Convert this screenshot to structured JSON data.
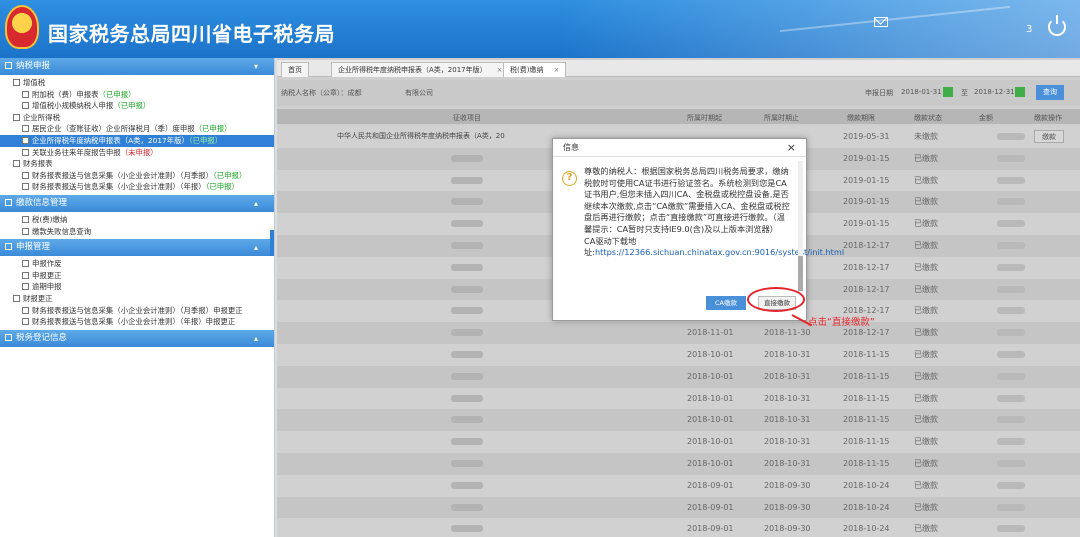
{
  "header": {
    "title": "国家税务总局四川省电子税务局",
    "user_num": "3"
  },
  "sidebar": {
    "sections": [
      {
        "title": "纳税申报",
        "items": [
          {
            "label": "增值税",
            "status": "",
            "level": 1
          },
          {
            "label": "附加税（费）申报表",
            "status": "（已申报）",
            "level": 2
          },
          {
            "label": "增值税小规模纳税人申报",
            "status": "（已申报）",
            "level": 2
          },
          {
            "label": "企业所得税",
            "status": "",
            "level": 1
          },
          {
            "label": "居民企业（查账征收）企业所得税月（季）度申报",
            "status": "（已申报）",
            "level": 2
          },
          {
            "label": "企业所得税年度纳税申报表（A类，2017年版）",
            "status": "（已申报）",
            "level": 2,
            "selected": true
          },
          {
            "label": "关联业务往来年度报告申报",
            "status": "（未申报）",
            "status_color": "red",
            "level": 2
          },
          {
            "label": "财务报表",
            "status": "",
            "level": 1
          },
          {
            "label": "财务报表报送与信息采集（小企业会计准则）（月季报）",
            "status": "（已申报）",
            "level": 2
          },
          {
            "label": "财务报表报送与信息采集（小企业会计准则）（年报）",
            "status": "（已申报）",
            "level": 2
          }
        ]
      },
      {
        "title": "缴款信息管理",
        "items": [
          {
            "label": "税(费)缴纳",
            "status": "",
            "level": 3
          },
          {
            "label": "缴款失败信息查询",
            "status": "",
            "level": 3
          }
        ]
      },
      {
        "title": "申报管理",
        "items": [
          {
            "label": "申报作废",
            "status": "",
            "level": 3
          },
          {
            "label": "申报更正",
            "status": "",
            "level": 3
          },
          {
            "label": "逾期申报",
            "status": "",
            "level": 3
          },
          {
            "label": "财报更正",
            "status": "",
            "level": 1
          },
          {
            "label": "财务报表报送与信息采集（小企业会计准则）（月季报）申报更正",
            "status": "",
            "level": 2
          },
          {
            "label": "财务报表报送与信息采集（小企业会计准则）（年报）申报更正",
            "status": "",
            "level": 2
          }
        ]
      },
      {
        "title": "税务登记信息",
        "items": []
      }
    ]
  },
  "tabs": [
    {
      "label": "首页"
    },
    {
      "label": "企业所得税年度纳税申报表（A类，2017年版）"
    },
    {
      "label": "税(费)缴纳"
    }
  ],
  "toolbar": {
    "taxpayer_label": "纳税人名称（公章）：成都",
    "taxpayer_suffix": "有限公司",
    "date_label": "申报日期",
    "date_from": "2018-01-31",
    "date_sep": "至",
    "date_to": "2018-12-31",
    "query_button": "查询"
  },
  "table": {
    "headers": [
      "征收项目",
      "所属时期起",
      "所属时期止",
      "缴款期限",
      "缴款状态",
      "金额",
      "缴款操作"
    ],
    "first_row_name": "中华人民共和国企业所得税年度纳税申报表（A类，20",
    "op_label": "缴款",
    "rows": [
      {
        "start": "",
        "end": "",
        "deadline": "2019-05-31",
        "status": "未缴款"
      },
      {
        "start": "",
        "end": "",
        "deadline": "2019-01-15",
        "status": "已缴款"
      },
      {
        "start": "",
        "end": "",
        "deadline": "2019-01-15",
        "status": "已缴款"
      },
      {
        "start": "",
        "end": "",
        "deadline": "2019-01-15",
        "status": "已缴款"
      },
      {
        "start": "",
        "end": "",
        "deadline": "2019-01-15",
        "status": "已缴款"
      },
      {
        "start": "",
        "end": "",
        "deadline": "2018-12-17",
        "status": "已缴款"
      },
      {
        "start": "",
        "end": "",
        "deadline": "2018-12-17",
        "status": "已缴款"
      },
      {
        "start": "",
        "end": "",
        "deadline": "2018-12-17",
        "status": "已缴款"
      },
      {
        "start": "",
        "end": "",
        "deadline": "2018-12-17",
        "status": "已缴款"
      },
      {
        "start": "2018-11-01",
        "end": "2018-11-30",
        "deadline": "2018-12-17",
        "status": "已缴款"
      },
      {
        "start": "2018-10-01",
        "end": "2018-10-31",
        "deadline": "2018-11-15",
        "status": "已缴款"
      },
      {
        "start": "2018-10-01",
        "end": "2018-10-31",
        "deadline": "2018-11-15",
        "status": "已缴款"
      },
      {
        "start": "2018-10-01",
        "end": "2018-10-31",
        "deadline": "2018-11-15",
        "status": "已缴款"
      },
      {
        "start": "2018-10-01",
        "end": "2018-10-31",
        "deadline": "2018-11-15",
        "status": "已缴款"
      },
      {
        "start": "2018-10-01",
        "end": "2018-10-31",
        "deadline": "2018-11-15",
        "status": "已缴款"
      },
      {
        "start": "2018-10-01",
        "end": "2018-10-31",
        "deadline": "2018-11-15",
        "status": "已缴款"
      },
      {
        "start": "2018-09-01",
        "end": "2018-09-30",
        "deadline": "2018-10-24",
        "status": "已缴款"
      },
      {
        "start": "2018-09-01",
        "end": "2018-09-30",
        "deadline": "2018-10-24",
        "status": "已缴款"
      },
      {
        "start": "2018-09-01",
        "end": "2018-09-30",
        "deadline": "2018-10-24",
        "status": "已缴款"
      },
      {
        "start": "2018-09-01",
        "end": "2018-09-30",
        "deadline": "2018-10-24",
        "status": "已缴款"
      }
    ]
  },
  "dialog": {
    "title": "信息",
    "close": "×",
    "body_text": "尊敬的纳税人：根据国家税务总局四川税务局要求，缴纳税款时可使用CA证书进行验证签名。系统检测到您是CA证书用户,但您未插入四川CA、金税盘或税控盘设备,是否继续本次缴款,点击“CA缴款”需要插入CA、金税盘或税控盘后再进行缴款；点击“直接缴款”可直接进行缴款。（温馨提示：CA暂时只支持IE9.0(含)及以上版本浏览器）",
    "download_label": "CA驱动下载地址:",
    "download_url": "https://12366.sichuan.chinatax.gov.cn:9016/systest/init.html",
    "ca_button": "CA缴款",
    "direct_button": "直接缴款"
  },
  "annotation": {
    "text": "点击“直接缴款”"
  }
}
